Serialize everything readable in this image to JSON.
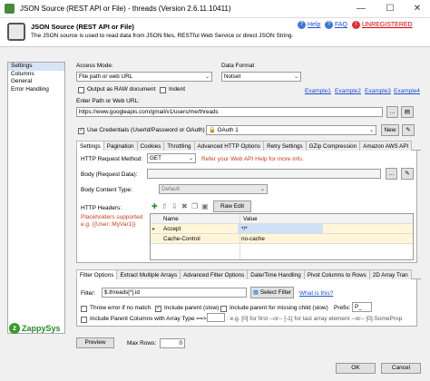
{
  "window": {
    "title": "JSON Source (REST API or File) - threads (Version 2.6.11.10411)"
  },
  "header": {
    "title": "JSON Source (REST API or File)",
    "subtitle": "The JSON source is used to read data from JSON files, RESTful Web Service or direct JSON String.",
    "help": "Help",
    "faq": "FAQ",
    "unregistered": "UNREGISTERED"
  },
  "nav": [
    "Settings",
    "Columns",
    "General",
    "Error Handling"
  ],
  "access": {
    "access_mode_label": "Access Mode:",
    "access_mode_value": "File path or web URL",
    "data_format_label": "Data Format",
    "data_format_value": "Notset",
    "output_raw": "Output as RAW document",
    "indent": "Indent",
    "examples": [
      "Example1",
      "Example2",
      "Example3",
      "Example4"
    ],
    "url_label": "Enter Path or Web URL:",
    "url_value": "https://www.googleapis.com/gmail/v1/users/me/threads",
    "use_credentials": "Use Credentials (UserId/Password or OAuth)",
    "connection_value": "OAuth 1",
    "new_btn": "New"
  },
  "req_tabs": [
    "Settings",
    "Pagination",
    "Cookies",
    "Throttling",
    "Advanced HTTP Options",
    "Retry Settings",
    "GZip Compression",
    "Amazon AWS API"
  ],
  "request": {
    "method_label": "HTTP Request Method:",
    "method_value": "GET",
    "method_hint": "Refer your Web API Help for more info.",
    "body_label": "Body (Request Data):",
    "content_type_label": "Body Content Type:",
    "content_type_value": "Default",
    "headers_label": "HTTP Headers:",
    "placeholder_hint": "Placeholders supported e.g. {{User::MyVar1}}",
    "raw_edit": "Raw Edit",
    "grid_cols": [
      "Name",
      "Value"
    ],
    "grid_rows": [
      {
        "name": "Accept",
        "value": "*/*"
      },
      {
        "name": "Cache-Control",
        "value": "no-cache"
      }
    ]
  },
  "filter_tabs": [
    "Filter Options",
    "Extract Multiple Arrays",
    "Advanced Filter Options",
    "Date/Time Handling",
    "Pivot Columns to Rows",
    "2D Array Tran"
  ],
  "filter": {
    "label": "Filter:",
    "value": "$.threads[*].id",
    "select_btn": "Select Filter",
    "what_link": "What is this?",
    "throw_error": "Throw error if no match",
    "include_parent": "Include parent (slow)",
    "include_parent_missing": "Include parent for missing child (slow)",
    "prefix_label": "Prefix:",
    "prefix_value": "P_",
    "include_parent_cols": "Include Parent Columns with Array Type ==> Filter",
    "filter_hint": ": e.g. [0] for first --or-- [-1] for last array element --or-- [0].SomeProp"
  },
  "logo": "ZappySys",
  "footer": {
    "preview": "Preview",
    "max_rows_label": "Max Rows:",
    "max_rows_value": "0",
    "ok": "OK",
    "cancel": "Cancel"
  }
}
